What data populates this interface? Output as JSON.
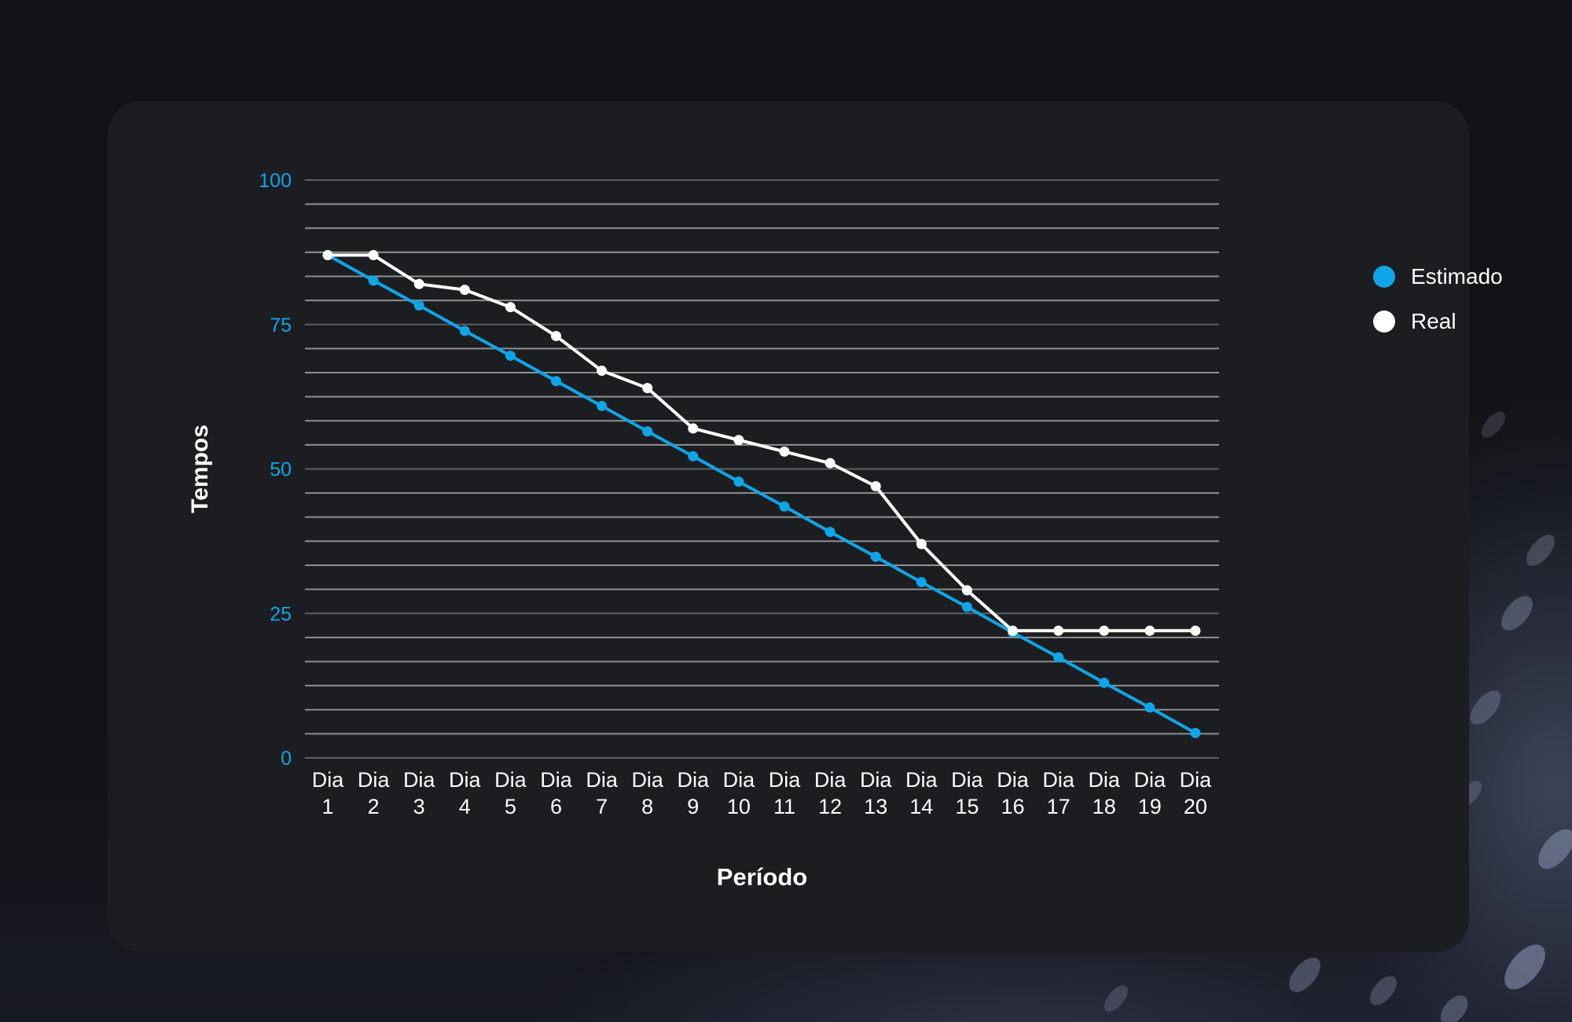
{
  "colors": {
    "estimado": "#0ea5e9",
    "real": "#ffffff",
    "y_tick_labels": "#0ea5e9"
  },
  "legend": {
    "items": [
      {
        "label": "Estimado",
        "color": "#0ea5e9"
      },
      {
        "label": "Real",
        "color": "#ffffff"
      }
    ]
  },
  "chart_data": {
    "type": "line",
    "title": "",
    "xlabel": "Período",
    "ylabel": "Tempos",
    "ylim": [
      0,
      100
    ],
    "y_ticks": [
      0,
      25,
      50,
      75,
      100
    ],
    "grid": true,
    "legend_position": "top-right",
    "categories": [
      [
        "Dia",
        "1"
      ],
      [
        "Dia",
        "2"
      ],
      [
        "Dia",
        "3"
      ],
      [
        "Dia",
        "4"
      ],
      [
        "Dia",
        "5"
      ],
      [
        "Dia",
        "6"
      ],
      [
        "Dia",
        "7"
      ],
      [
        "Dia",
        "8"
      ],
      [
        "Dia",
        "9"
      ],
      [
        "Dia",
        "10"
      ],
      [
        "Dia",
        "11"
      ],
      [
        "Dia",
        "12"
      ],
      [
        "Dia",
        "13"
      ],
      [
        "Dia",
        "14"
      ],
      [
        "Dia",
        "15"
      ],
      [
        "Dia",
        "16"
      ],
      [
        "Dia",
        "17"
      ],
      [
        "Dia",
        "18"
      ],
      [
        "Dia",
        "19"
      ],
      [
        "Dia",
        "20"
      ]
    ],
    "series": [
      {
        "name": "Estimado",
        "color": "#0ea5e9",
        "values": [
          87,
          82.6,
          78.3,
          73.9,
          69.6,
          65.2,
          60.9,
          56.5,
          52.2,
          47.8,
          43.5,
          39.1,
          34.8,
          30.4,
          26.1,
          21.7,
          17.4,
          13.0,
          8.7,
          4.3
        ]
      },
      {
        "name": "Real",
        "color": "#ffffff",
        "values": [
          87,
          87,
          82,
          81,
          78,
          73,
          67,
          64,
          57,
          55,
          53,
          51,
          47,
          37,
          29,
          22,
          22,
          22,
          22,
          22
        ]
      }
    ]
  }
}
